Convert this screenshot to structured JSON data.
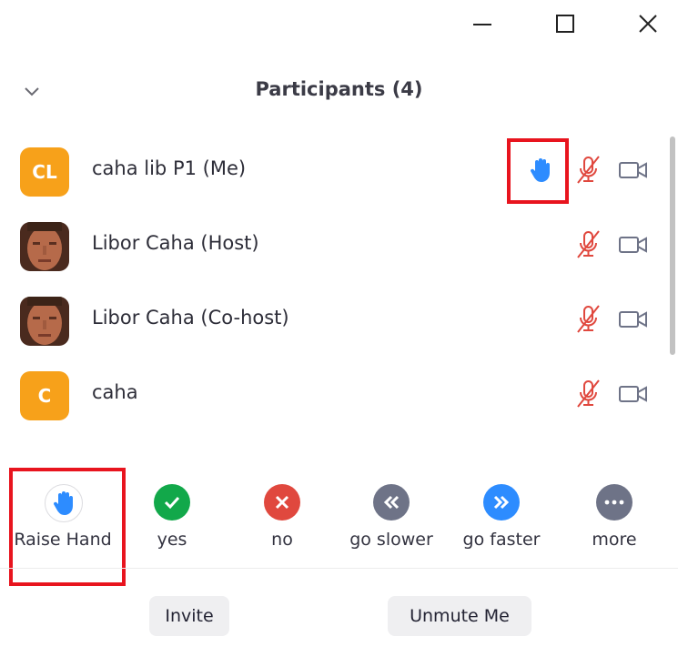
{
  "window": {
    "controls": [
      "minimize-icon",
      "maximize-icon",
      "close-icon"
    ]
  },
  "header": {
    "title": "Participants (4)",
    "collapse_icon": "chevron-down-icon"
  },
  "participants": [
    {
      "name": "caha lib P1 (Me)",
      "avatar": "initials",
      "initials": "CL",
      "avatar_color": "#f7a11a",
      "hand_raised": true,
      "mic": "muted",
      "video": "off"
    },
    {
      "name": "Libor Caha (Host)",
      "avatar": "photo",
      "initials": "",
      "hand_raised": false,
      "mic": "muted",
      "video": "off"
    },
    {
      "name": "Libor Caha (Co-host)",
      "avatar": "photo",
      "initials": "",
      "hand_raised": false,
      "mic": "muted",
      "video": "off"
    },
    {
      "name": "caha",
      "avatar": "initials",
      "initials": "C",
      "avatar_color": "#f7a11a",
      "hand_raised": false,
      "mic": "muted",
      "video": "off"
    }
  ],
  "reactions": [
    {
      "label": "Raise Hand",
      "icon": "hand-icon",
      "color": "#ffffff"
    },
    {
      "label": "yes",
      "icon": "check-icon",
      "color": "#12a84a"
    },
    {
      "label": "no",
      "icon": "x-icon",
      "color": "#e0483e"
    },
    {
      "label": "go slower",
      "icon": "rewind-icon",
      "color": "#6e7387"
    },
    {
      "label": "go faster",
      "icon": "fast-forward-icon",
      "color": "#2d8cff"
    },
    {
      "label": "more",
      "icon": "more-icon",
      "color": "#6e7387"
    }
  ],
  "footer": {
    "invite_label": "Invite",
    "unmute_label": "Unmute Me"
  },
  "colors": {
    "accent_blue": "#2d8cff",
    "muted_red": "#e0483e",
    "highlight_red": "#e8141e"
  }
}
